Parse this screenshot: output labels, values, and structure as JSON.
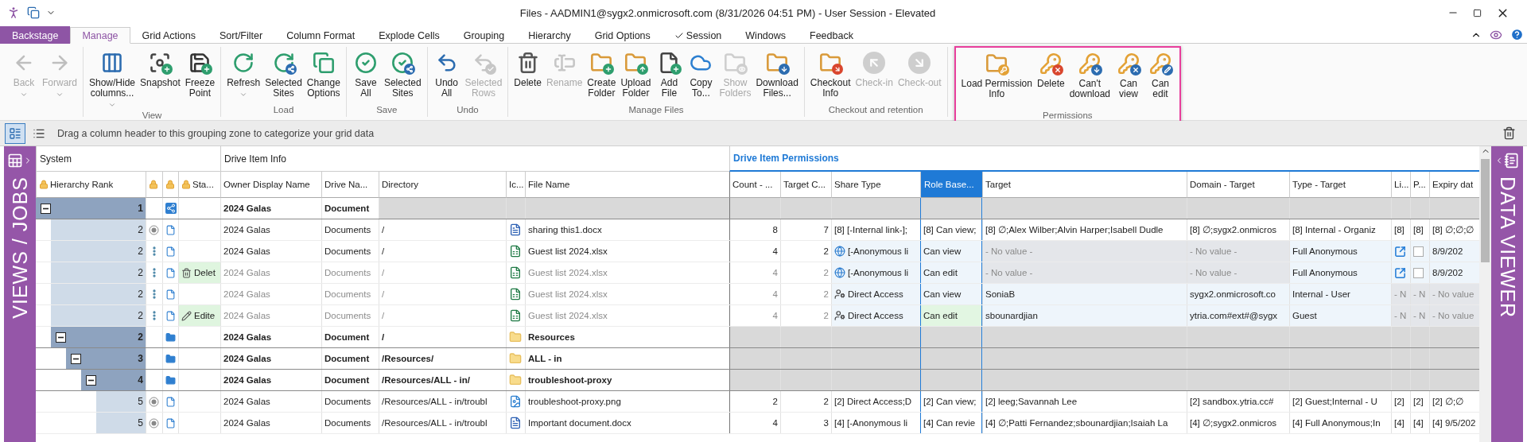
{
  "window": {
    "title": "Files - AADMIN1@sygx2.onmicrosoft.com (8/31/2026 04:51 PM) - User Session - Elevated"
  },
  "tabs": [
    {
      "label": "Backstage",
      "kind": "backstage",
      "selected": false
    },
    {
      "label": "Manage",
      "kind": "tab",
      "selected": true
    },
    {
      "label": "Grid Actions",
      "kind": "tab",
      "selected": false
    },
    {
      "label": "Sort/Filter",
      "kind": "tab",
      "selected": false
    },
    {
      "label": "Column Format",
      "kind": "tab",
      "selected": false
    },
    {
      "label": "Explode Cells",
      "kind": "tab",
      "selected": false
    },
    {
      "label": "Grouping",
      "kind": "tab",
      "selected": false
    },
    {
      "label": "Hierarchy",
      "kind": "tab",
      "selected": false
    },
    {
      "label": "Grid Options",
      "kind": "tab",
      "selected": false
    },
    {
      "label": "Session",
      "kind": "check",
      "selected": false
    },
    {
      "label": "Windows",
      "kind": "tab",
      "selected": false
    },
    {
      "label": "Feedback",
      "kind": "tab",
      "selected": false
    }
  ],
  "ribbon": {
    "groups": [
      {
        "highlighted": false,
        "buttons": [
          {
            "kind": "back",
            "label": "Back",
            "disabled": true,
            "caret": true
          },
          {
            "kind": "forward",
            "label": "Forward",
            "disabled": true,
            "caret": true
          }
        ]
      },
      {
        "label": "View",
        "highlighted": false,
        "buttons": [
          {
            "kind": "columns",
            "label": "Show/Hide\ncolumns...",
            "disabled": false,
            "caret": true
          },
          {
            "kind": "snapshot",
            "label": "Snapshot",
            "disabled": false,
            "caret": false
          },
          {
            "kind": "freeze",
            "label": "Freeze\nPoint",
            "disabled": false,
            "caret": false
          }
        ]
      },
      {
        "label": "Load",
        "highlighted": false,
        "buttons": [
          {
            "kind": "refresh",
            "label": "Refresh",
            "disabled": false,
            "caret": true
          },
          {
            "kind": "refresh_sites",
            "label": "Selected\nSites",
            "disabled": false,
            "caret": false
          },
          {
            "kind": "options",
            "label": "Change\nOptions",
            "disabled": false,
            "caret": false
          }
        ]
      },
      {
        "label": "Save",
        "highlighted": false,
        "buttons": [
          {
            "kind": "save_all",
            "label": "Save\nAll",
            "disabled": false,
            "caret": false
          },
          {
            "kind": "save_sites",
            "label": "Selected\nSites",
            "disabled": false,
            "caret": false
          }
        ]
      },
      {
        "label": "Undo",
        "highlighted": false,
        "buttons": [
          {
            "kind": "undo",
            "label": "Undo\nAll",
            "disabled": false,
            "caret": false
          },
          {
            "kind": "undo_rows",
            "label": "Selected\nRows",
            "disabled": true,
            "caret": false
          }
        ]
      },
      {
        "label": "Manage Files",
        "highlighted": false,
        "buttons": [
          {
            "kind": "delete",
            "label": "Delete",
            "disabled": false,
            "caret": false
          },
          {
            "kind": "rename",
            "label": "Rename",
            "disabled": true,
            "caret": false
          },
          {
            "kind": "create_folder",
            "label": "Create\nFolder",
            "disabled": false,
            "caret": false
          },
          {
            "kind": "upload_folder",
            "label": "Upload\nFolder",
            "disabled": false,
            "caret": false
          },
          {
            "kind": "add_file",
            "label": "Add\nFile",
            "disabled": false,
            "caret": false
          },
          {
            "kind": "copy_to",
            "label": "Copy\nTo...",
            "disabled": false,
            "caret": false
          },
          {
            "kind": "show_folders",
            "label": "Show\nFolders",
            "disabled": true,
            "caret": false
          },
          {
            "kind": "download",
            "label": "Download\nFiles...",
            "disabled": false,
            "caret": false
          }
        ]
      },
      {
        "label": "Checkout and retention",
        "highlighted": false,
        "buttons": [
          {
            "kind": "checkout_info",
            "label": "Checkout\nInfo",
            "disabled": false,
            "caret": false
          },
          {
            "kind": "check_in",
            "label": "Check-in",
            "disabled": true,
            "caret": false
          },
          {
            "kind": "check_out",
            "label": "Check-out",
            "disabled": true,
            "caret": false
          }
        ]
      },
      {
        "label": "Permissions",
        "highlighted": true,
        "buttons": [
          {
            "kind": "load_permission",
            "label": "Load Permission\nInfo",
            "disabled": false,
            "caret": false
          },
          {
            "kind": "key_delete",
            "label": "Delete",
            "disabled": false,
            "caret": false
          },
          {
            "kind": "key_no_download",
            "label": "Can't\ndownload",
            "disabled": false,
            "caret": false
          },
          {
            "kind": "key_view",
            "label": "Can\nview",
            "disabled": false,
            "caret": false
          },
          {
            "kind": "key_edit",
            "label": "Can\nedit",
            "disabled": false,
            "caret": false
          }
        ]
      }
    ]
  },
  "grouping_bar": {
    "hint": "Drag a column header to this grouping zone to categorize your grid data",
    "views": [
      {
        "kind": "detail",
        "selected": true
      },
      {
        "kind": "list",
        "selected": false
      }
    ]
  },
  "left_panel": {
    "label": "VIEWS / JOBS"
  },
  "right_panel": {
    "label": "DATA VIEWER"
  },
  "grid": {
    "bands": [
      {
        "label": "System",
        "accent": false
      },
      {
        "label": "Drive Item Info",
        "accent": false
      },
      {
        "label": "Drive Item Permissions",
        "accent": true
      }
    ],
    "columns": [
      {
        "label": "Hierarchy Rank",
        "locked": true,
        "selected": false
      },
      {
        "locked": true,
        "selected": false
      },
      {
        "locked": true,
        "selected": false
      },
      {
        "label": "Sta...",
        "locked": true,
        "selected": false
      },
      {
        "label": "Owner Display Name",
        "locked": false,
        "selected": false
      },
      {
        "label": "Drive Na...",
        "locked": false,
        "selected": false
      },
      {
        "label": "Directory",
        "locked": false,
        "selected": false
      },
      {
        "label": "Ic...",
        "locked": false,
        "selected": false
      },
      {
        "label": "File Name",
        "locked": false,
        "selected": false
      },
      {
        "label": "Count - ...",
        "locked": false,
        "selected": false
      },
      {
        "label": "Target C...",
        "locked": false,
        "selected": false
      },
      {
        "label": "Share Type",
        "locked": false,
        "selected": false
      },
      {
        "label": "Role Base...",
        "locked": false,
        "selected": true
      },
      {
        "label": "Target",
        "locked": false,
        "selected": false
      },
      {
        "label": "Domain - Target",
        "locked": false,
        "selected": false
      },
      {
        "label": "Type - Target",
        "locked": false,
        "selected": false
      },
      {
        "label": "Li...",
        "locked": false,
        "selected": false
      },
      {
        "label": "P...",
        "locked": false,
        "selected": false
      },
      {
        "label": "Expiry dat",
        "locked": false,
        "selected": false
      }
    ],
    "rows": [
      {
        "rank": "1",
        "expanded": true,
        "item": {
          "kind": "drive"
        },
        "dimmed": false,
        "owner": "2024 Galas",
        "drive": "Document",
        "children": [
          {
            "rank": "2",
            "marker": {
              "kind": "radio"
            },
            "item": {
              "kind": "file"
            },
            "dimmed": false,
            "exploded": false,
            "owner": "2024 Galas",
            "drive": "Documents",
            "directory": "/",
            "file_icon": {
              "kind": "word"
            },
            "file_name": "sharing this1.docx",
            "count": "8",
            "target_count": "7",
            "permissions": [
              {
                "kind": "text",
                "text": "[8] [-Internal link-];"
              },
              {
                "kind": "text",
                "text": "[8] Can view;"
              },
              {
                "kind": "text",
                "text": "[8] ∅;Alex Wilber;Alvin Harper;Isabell Dudle"
              },
              {
                "kind": "text",
                "text": "[8] ∅;sygx2.onmicros"
              },
              {
                "kind": "text",
                "text": "[8] Internal - Organiz"
              },
              {
                "kind": "text",
                "text": "[8]"
              },
              {
                "kind": "text",
                "text": "[8]"
              },
              {
                "kind": "text",
                "text": "[8] ∅;∅;∅"
              }
            ]
          },
          {
            "rank": "2",
            "marker": {
              "kind": "menu"
            },
            "item": {
              "kind": "file"
            },
            "dimmed": false,
            "exploded": true,
            "owner": "2024 Galas",
            "drive": "Documents",
            "directory": "/",
            "file_icon": {
              "kind": "excel"
            },
            "file_name": "Guest list 2024.xlsx",
            "count": "4",
            "target_count": "2",
            "permissions": [
              {
                "kind": "text",
                "badge": {
                  "kind": "globe"
                },
                "text": "[-Anonymous li"
              },
              {
                "kind": "text",
                "text": "Can view"
              },
              {
                "kind": "missing",
                "text": "- No value -"
              },
              {
                "kind": "missing",
                "text": "- No value -"
              },
              {
                "kind": "text",
                "text": "Full Anonymous"
              },
              {
                "kind": "link"
              },
              {
                "kind": "checkbox",
                "checked": false
              },
              {
                "kind": "text",
                "text": "8/9/202"
              }
            ]
          },
          {
            "rank": "2",
            "marker": {
              "kind": "menu"
            },
            "item": {
              "kind": "file"
            },
            "dimmed": true,
            "exploded": true,
            "status": {
              "kind": "delete",
              "text": "Delet"
            },
            "owner": "2024 Galas",
            "drive": "Documents",
            "directory": "/",
            "file_icon": {
              "kind": "excel"
            },
            "file_name": "Guest list 2024.xlsx",
            "count": "4",
            "target_count": "2",
            "permissions": [
              {
                "kind": "text",
                "badge": {
                  "kind": "globe"
                },
                "text": "[-Anonymous li"
              },
              {
                "kind": "text",
                "text": "Can edit"
              },
              {
                "kind": "missing",
                "text": "- No value -"
              },
              {
                "kind": "missing",
                "text": "- No value -"
              },
              {
                "kind": "text",
                "text": "Full Anonymous"
              },
              {
                "kind": "link"
              },
              {
                "kind": "checkbox",
                "checked": false
              },
              {
                "kind": "text",
                "text": "8/9/202"
              }
            ]
          },
          {
            "rank": "2",
            "marker": {
              "kind": "menu"
            },
            "item": {
              "kind": "file"
            },
            "dimmed": true,
            "exploded": true,
            "owner": "2024 Galas",
            "drive": "Documents",
            "directory": "/",
            "file_icon": {
              "kind": "excel"
            },
            "file_name": "Guest list 2024.xlsx",
            "count": "4",
            "target_count": "2",
            "permissions": [
              {
                "kind": "text",
                "badge": {
                  "kind": "person"
                },
                "text": "Direct Access"
              },
              {
                "kind": "text",
                "text": "Can view"
              },
              {
                "kind": "text",
                "text": "SoniaB"
              },
              {
                "kind": "text",
                "text": "sygx2.onmicrosoft.co"
              },
              {
                "kind": "text",
                "text": "Internal - User"
              },
              {
                "kind": "missing",
                "text": "- N"
              },
              {
                "kind": "missing",
                "text": "- N"
              },
              {
                "kind": "missing",
                "text": "- No value"
              }
            ]
          },
          {
            "rank": "2",
            "marker": {
              "kind": "menu"
            },
            "item": {
              "kind": "file"
            },
            "dimmed": true,
            "exploded": true,
            "status": {
              "kind": "edit",
              "text": "Edite"
            },
            "owner": "2024 Galas",
            "drive": "Documents",
            "directory": "/",
            "file_icon": {
              "kind": "excel"
            },
            "file_name": "Guest list 2024.xlsx",
            "count": "4",
            "target_count": "2",
            "permissions": [
              {
                "kind": "text",
                "badge": {
                  "kind": "person"
                },
                "text": "Direct Access"
              },
              {
                "kind": "text",
                "text": "Can edit"
              },
              {
                "kind": "text",
                "text": "sbounardjian"
              },
              {
                "kind": "text",
                "text": "ytria.com#ext#@sygx"
              },
              {
                "kind": "text",
                "text": "Guest"
              },
              {
                "kind": "missing",
                "text": "- N"
              },
              {
                "kind": "missing",
                "text": "- N"
              },
              {
                "kind": "missing",
                "text": "- No value"
              }
            ]
          },
          {
            "rank": "2",
            "expanded": true,
            "item": {
              "kind": "folder"
            },
            "dimmed": false,
            "owner": "2024 Galas",
            "drive": "Document",
            "directory": "/",
            "file_icon": {
              "kind": "folder"
            },
            "file_name": "Resources",
            "children": [
              {
                "rank": "3",
                "expanded": true,
                "item": {
                  "kind": "folder"
                },
                "dimmed": false,
                "owner": "2024 Galas",
                "drive": "Document",
                "directory": "/Resources/",
                "file_icon": {
                  "kind": "folder"
                },
                "file_name": "ALL - in",
                "children": [
                  {
                    "rank": "4",
                    "expanded": true,
                    "item": {
                      "kind": "folder"
                    },
                    "dimmed": false,
                    "owner": "2024 Galas",
                    "drive": "Document",
                    "directory": "/Resources/ALL - in/",
                    "file_icon": {
                      "kind": "folder"
                    },
                    "file_name": "troubleshoot-proxy",
                    "children": [
                      {
                        "rank": "5",
                        "marker": {
                          "kind": "radio"
                        },
                        "item": {
                          "kind": "file"
                        },
                        "dimmed": false,
                        "exploded": false,
                        "owner": "2024 Galas",
                        "drive": "Documents",
                        "directory": "/Resources/ALL - in/troubl",
                        "file_icon": {
                          "kind": "image"
                        },
                        "file_name": "troubleshoot-proxy.png",
                        "count": "2",
                        "target_count": "2",
                        "permissions": [
                          {
                            "kind": "text",
                            "text": "[2] Direct Access;D"
                          },
                          {
                            "kind": "text",
                            "text": "[2] Can view;"
                          },
                          {
                            "kind": "text",
                            "text": "[2] leeg;Savannah Lee"
                          },
                          {
                            "kind": "text",
                            "text": "[2] sandbox.ytria.cc#"
                          },
                          {
                            "kind": "text",
                            "text": "[2] Guest;Internal - U"
                          },
                          {
                            "kind": "text",
                            "text": "[2]"
                          },
                          {
                            "kind": "text",
                            "text": "[2]"
                          },
                          {
                            "kind": "text",
                            "text": "[2] ∅;∅"
                          }
                        ]
                      },
                      {
                        "rank": "5",
                        "marker": {
                          "kind": "radio"
                        },
                        "item": {
                          "kind": "file"
                        },
                        "dimmed": false,
                        "exploded": false,
                        "owner": "2024 Galas",
                        "drive": "Documents",
                        "directory": "/Resources/ALL - in/troubl",
                        "file_icon": {
                          "kind": "word"
                        },
                        "file_name": "Important document.docx",
                        "count": "4",
                        "target_count": "3",
                        "permissions": [
                          {
                            "kind": "text",
                            "text": "[4] [-Anonymous li"
                          },
                          {
                            "kind": "text",
                            "text": "[4] Can revie"
                          },
                          {
                            "kind": "text",
                            "text": "[4] ∅;Patti Fernandez;sbounardjian;Isaiah La"
                          },
                          {
                            "kind": "text",
                            "text": "[4] ∅;sygx2.onmicros"
                          },
                          {
                            "kind": "text",
                            "text": "[4] Full Anonymous;In"
                          },
                          {
                            "kind": "text",
                            "text": "[4]"
                          },
                          {
                            "kind": "text",
                            "text": "[4]"
                          },
                          {
                            "kind": "text",
                            "text": "[4] 9/5/202"
                          }
                        ]
                      }
                    ]
                  }
                ]
              }
            ]
          }
        ]
      }
    ]
  }
}
